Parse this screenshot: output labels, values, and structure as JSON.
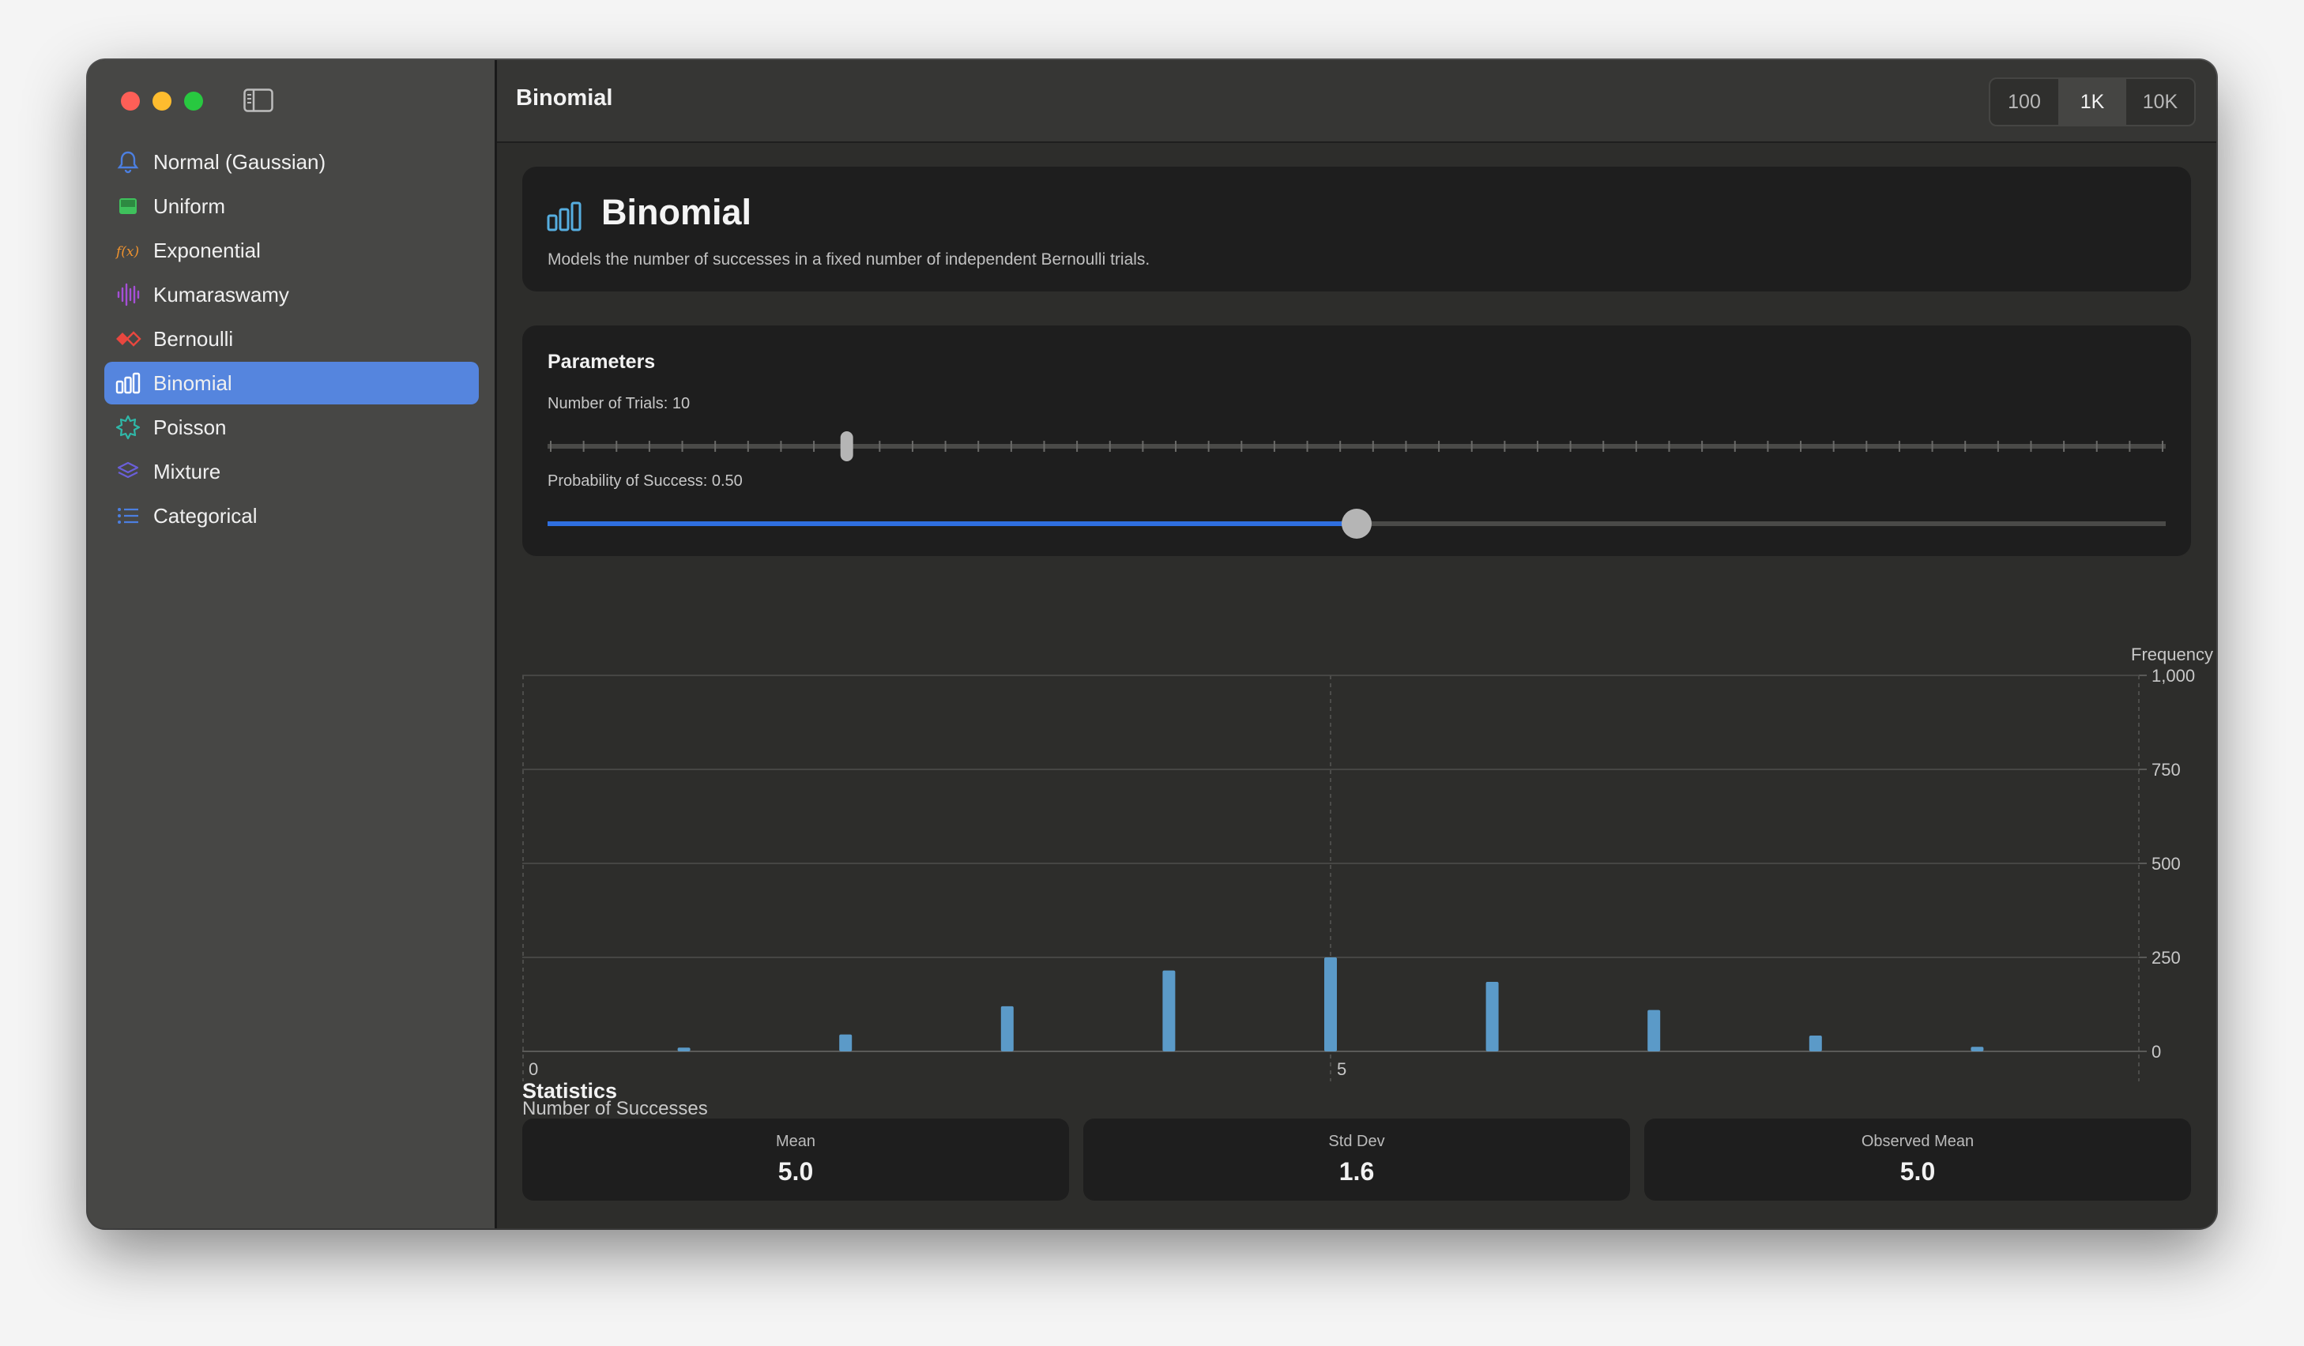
{
  "window": {
    "title": "Binomial"
  },
  "sidebar": {
    "items": [
      {
        "label": "Normal (Gaussian)",
        "icon": "bell-icon",
        "color": "#4c7fe0"
      },
      {
        "label": "Uniform",
        "icon": "rectangle-icon",
        "color": "#3fc15c"
      },
      {
        "label": "Exponential",
        "icon": "function-icon",
        "color": "#f0932e"
      },
      {
        "label": "Kumaraswamy",
        "icon": "waveform-icon",
        "color": "#a54fd6"
      },
      {
        "label": "Bernoulli",
        "icon": "coin-flip-icon",
        "color": "#e8473f"
      },
      {
        "label": "Binomial",
        "icon": "bar-chart-icon",
        "color": "#ffffff",
        "selected": true
      },
      {
        "label": "Poisson",
        "icon": "burst-icon",
        "color": "#2fb8a8"
      },
      {
        "label": "Mixture",
        "icon": "layers-icon",
        "color": "#6a5fd8"
      },
      {
        "label": "Categorical",
        "icon": "list-icon",
        "color": "#4c7fe0"
      }
    ]
  },
  "toolbar": {
    "sample_sizes": [
      {
        "label": "100",
        "active": false
      },
      {
        "label": "1K",
        "active": true
      },
      {
        "label": "10K",
        "active": false
      }
    ]
  },
  "header": {
    "title": "Binomial",
    "icon": "bar-chart-icon",
    "icon_color": "#56aee0",
    "description": "Models the number of successes in a fixed number of independent Bernoulli trials."
  },
  "parameters": {
    "title": "Parameters",
    "trials": {
      "label": "Number of Trials: 10",
      "value": 10,
      "min": 1,
      "max": 50
    },
    "probability": {
      "label": "Probability of Success: 0.50",
      "value": 0.5,
      "min": 0,
      "max": 1,
      "accent": "#2f6fe0"
    }
  },
  "chart_data": {
    "type": "bar",
    "x": [
      1,
      2,
      3,
      4,
      5,
      6,
      7,
      8,
      9
    ],
    "values": [
      10,
      45,
      120,
      215,
      250,
      185,
      110,
      42,
      12
    ],
    "xlabel": "Number of Successes",
    "ylabel": "Frequency",
    "xlim": [
      0,
      10
    ],
    "ylim": [
      0,
      1000
    ],
    "y_ticks": [
      "1,000",
      "750",
      "500",
      "250",
      "0"
    ],
    "x_ticks": [
      "0",
      "5"
    ],
    "bar_color": "#5b9ac8",
    "grid": true
  },
  "statistics": {
    "title": "Statistics",
    "items": [
      {
        "label": "Mean",
        "value": "5.0"
      },
      {
        "label": "Std Dev",
        "value": "1.6"
      },
      {
        "label": "Observed Mean",
        "value": "5.0"
      }
    ]
  }
}
